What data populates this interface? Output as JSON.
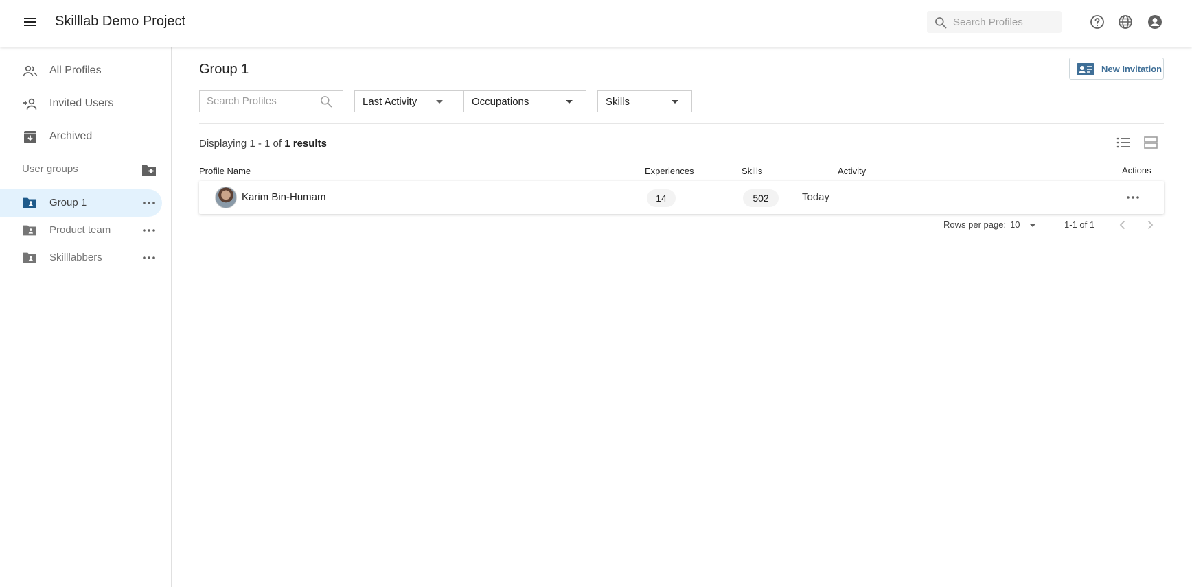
{
  "header": {
    "title": "Skilllab Demo Project",
    "search_placeholder": "Search Profiles",
    "icons": [
      "menu-icon",
      "search-icon",
      "help-icon",
      "globe-icon",
      "account-icon"
    ]
  },
  "sidebar": {
    "items": [
      {
        "label": "All Profiles",
        "icon": "people-icon"
      },
      {
        "label": "Invited Users",
        "icon": "person-add-icon"
      },
      {
        "label": "Archived",
        "icon": "archive-icon"
      }
    ],
    "groups_label": "User groups",
    "groups": [
      {
        "label": "Group 1",
        "active": true
      },
      {
        "label": "Product team",
        "active": false
      },
      {
        "label": "Skilllabbers",
        "active": false
      }
    ]
  },
  "main": {
    "title": "Group 1",
    "new_invitation_label": "New Invitation",
    "filters": {
      "search_placeholder": "Search Profiles",
      "last_activity": "Last Activity",
      "occupations": "Occupations",
      "skills": "Skills"
    },
    "results": {
      "prefix": "Displaying 1 - 1 of",
      "count": "1 results"
    },
    "table": {
      "headers": {
        "name": "Profile Name",
        "experiences": "Experiences",
        "skills": "Skills",
        "activity": "Activity",
        "actions": "Actions"
      },
      "rows": [
        {
          "name": "Karim Bin-Humam",
          "experiences": "14",
          "skills": "502",
          "activity": "Today"
        }
      ]
    },
    "pagination": {
      "rows_per_page_label": "Rows per page:",
      "rows_per_page": "10",
      "range": "1-1 of 1"
    }
  },
  "colors": {
    "accent": "#1e5a8a",
    "active_bg": "#e3f2fd",
    "invite_text": "#3f6f97"
  }
}
